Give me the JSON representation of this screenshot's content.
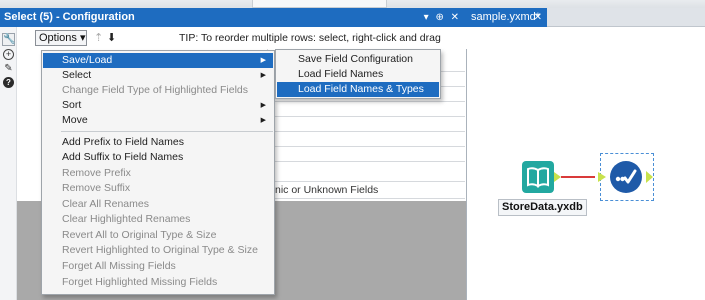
{
  "config_panel": {
    "title": "Select (5) - Configuration",
    "title_controls": "▾ ⊕ ✕",
    "options_button": "Options ▾",
    "move_up": "⇡",
    "move_down": "⬇",
    "tip": "TIP: To reorder multiple rows: select, right-click and drag",
    "grid_bottom_text": "nic or Unknown Fields"
  },
  "options_menu": {
    "items": [
      {
        "label": "Save/Load",
        "submenu": true,
        "enabled": true,
        "highlighted": true
      },
      {
        "label": "Select",
        "submenu": true,
        "enabled": true
      },
      {
        "label": "Change Field Type of Highlighted Fields",
        "enabled": false
      },
      {
        "label": "Sort",
        "submenu": true,
        "enabled": true
      },
      {
        "label": "Move",
        "submenu": true,
        "enabled": true
      },
      {
        "label": "Add Prefix to Field Names",
        "enabled": true
      },
      {
        "label": "Add Suffix to Field Names",
        "enabled": true
      },
      {
        "label": "Remove Prefix",
        "enabled": false
      },
      {
        "label": "Remove Suffix",
        "enabled": false
      },
      {
        "label": "Clear All Renames",
        "enabled": false
      },
      {
        "label": "Clear Highlighted Renames",
        "enabled": false
      },
      {
        "label": "Revert All to Original Type & Size",
        "enabled": false
      },
      {
        "label": "Revert Highlighted to Original Type & Size",
        "enabled": false
      },
      {
        "label": "Forget All Missing Fields",
        "enabled": false
      },
      {
        "label": "Forget Highlighted Missing Fields",
        "enabled": false
      }
    ]
  },
  "save_load_submenu": {
    "items": [
      {
        "label": "Save Field Configuration"
      },
      {
        "label": "Load Field Names"
      },
      {
        "label": "Load Field Names & Types",
        "highlighted": true
      }
    ]
  },
  "canvas": {
    "tab_label": "sample.yxmd*",
    "tab_close": "✕",
    "input_tool_label": "StoreData.yxdb",
    "connection_color": "#d93a3a"
  },
  "colors": {
    "accent": "#1e6cc0",
    "input_tool": "#22a8a0",
    "select_tool": "#1f5aa8",
    "anchor": "#c8e24c"
  }
}
